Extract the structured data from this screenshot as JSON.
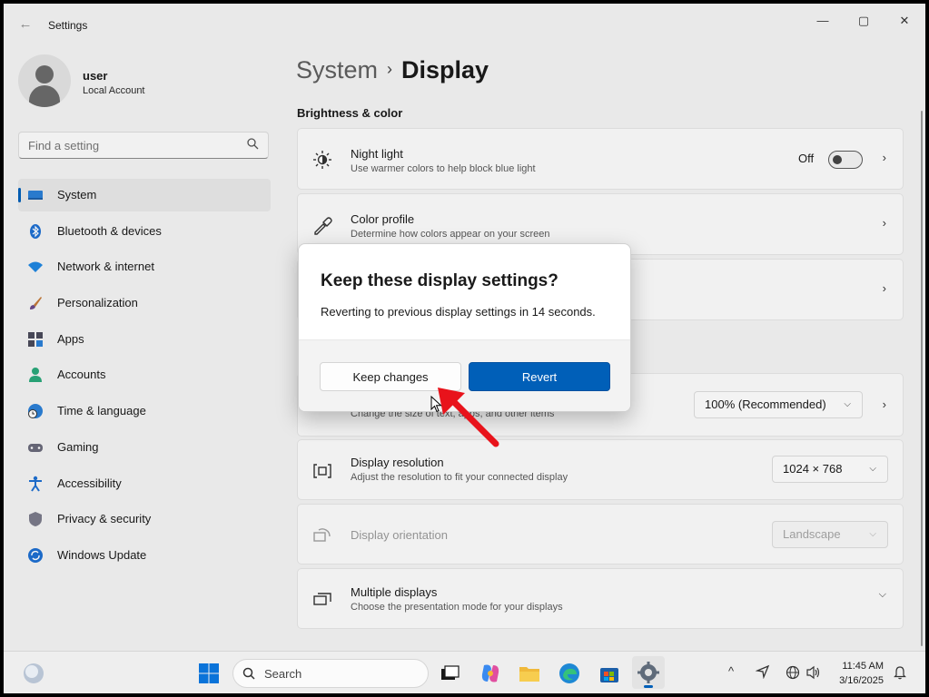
{
  "window": {
    "title": "Settings",
    "controls": {
      "minimize": "—",
      "maximize": "▢",
      "close": "✕"
    }
  },
  "user": {
    "name": "user",
    "account_type": "Local Account"
  },
  "search": {
    "placeholder": "Find a setting"
  },
  "sidebar": {
    "items": [
      {
        "label": "System",
        "icon": "monitor-icon",
        "active": true
      },
      {
        "label": "Bluetooth & devices",
        "icon": "bluetooth-icon"
      },
      {
        "label": "Network & internet",
        "icon": "wifi-icon"
      },
      {
        "label": "Personalization",
        "icon": "brush-icon"
      },
      {
        "label": "Apps",
        "icon": "apps-icon"
      },
      {
        "label": "Accounts",
        "icon": "person-icon"
      },
      {
        "label": "Time & language",
        "icon": "globe-clock-icon"
      },
      {
        "label": "Gaming",
        "icon": "controller-icon"
      },
      {
        "label": "Accessibility",
        "icon": "accessibility-icon"
      },
      {
        "label": "Privacy & security",
        "icon": "shield-icon"
      },
      {
        "label": "Windows Update",
        "icon": "update-icon"
      }
    ]
  },
  "breadcrumb": {
    "parent": "System",
    "separator": "›",
    "current": "Display"
  },
  "section_heading": "Brightness & color",
  "cards": {
    "night_light": {
      "title": "Night light",
      "subtitle": "Use warmer colors to help block blue light",
      "toggle_state": "Off"
    },
    "color_profile": {
      "title": "Color profile",
      "subtitle": "Determine how colors appear on your screen"
    },
    "scale": {
      "subtitle": "Change the size of text, apps, and other items",
      "value": "100% (Recommended)"
    },
    "resolution": {
      "title": "Display resolution",
      "subtitle": "Adjust the resolution to fit your connected display",
      "value": "1024 × 768"
    },
    "orientation": {
      "title": "Display orientation",
      "value": "Landscape"
    },
    "multiple": {
      "title": "Multiple displays",
      "subtitle": "Choose the presentation mode for your displays"
    }
  },
  "dialog": {
    "title": "Keep these display settings?",
    "message": "Reverting to previous display settings in 14 seconds.",
    "keep_label": "Keep changes",
    "revert_label": "Revert"
  },
  "taskbar": {
    "search_label": "Search",
    "time": "11:45 AM",
    "date": "3/16/2025"
  },
  "colors": {
    "accent": "#005fb8",
    "annotation_arrow": "#e8131b"
  }
}
